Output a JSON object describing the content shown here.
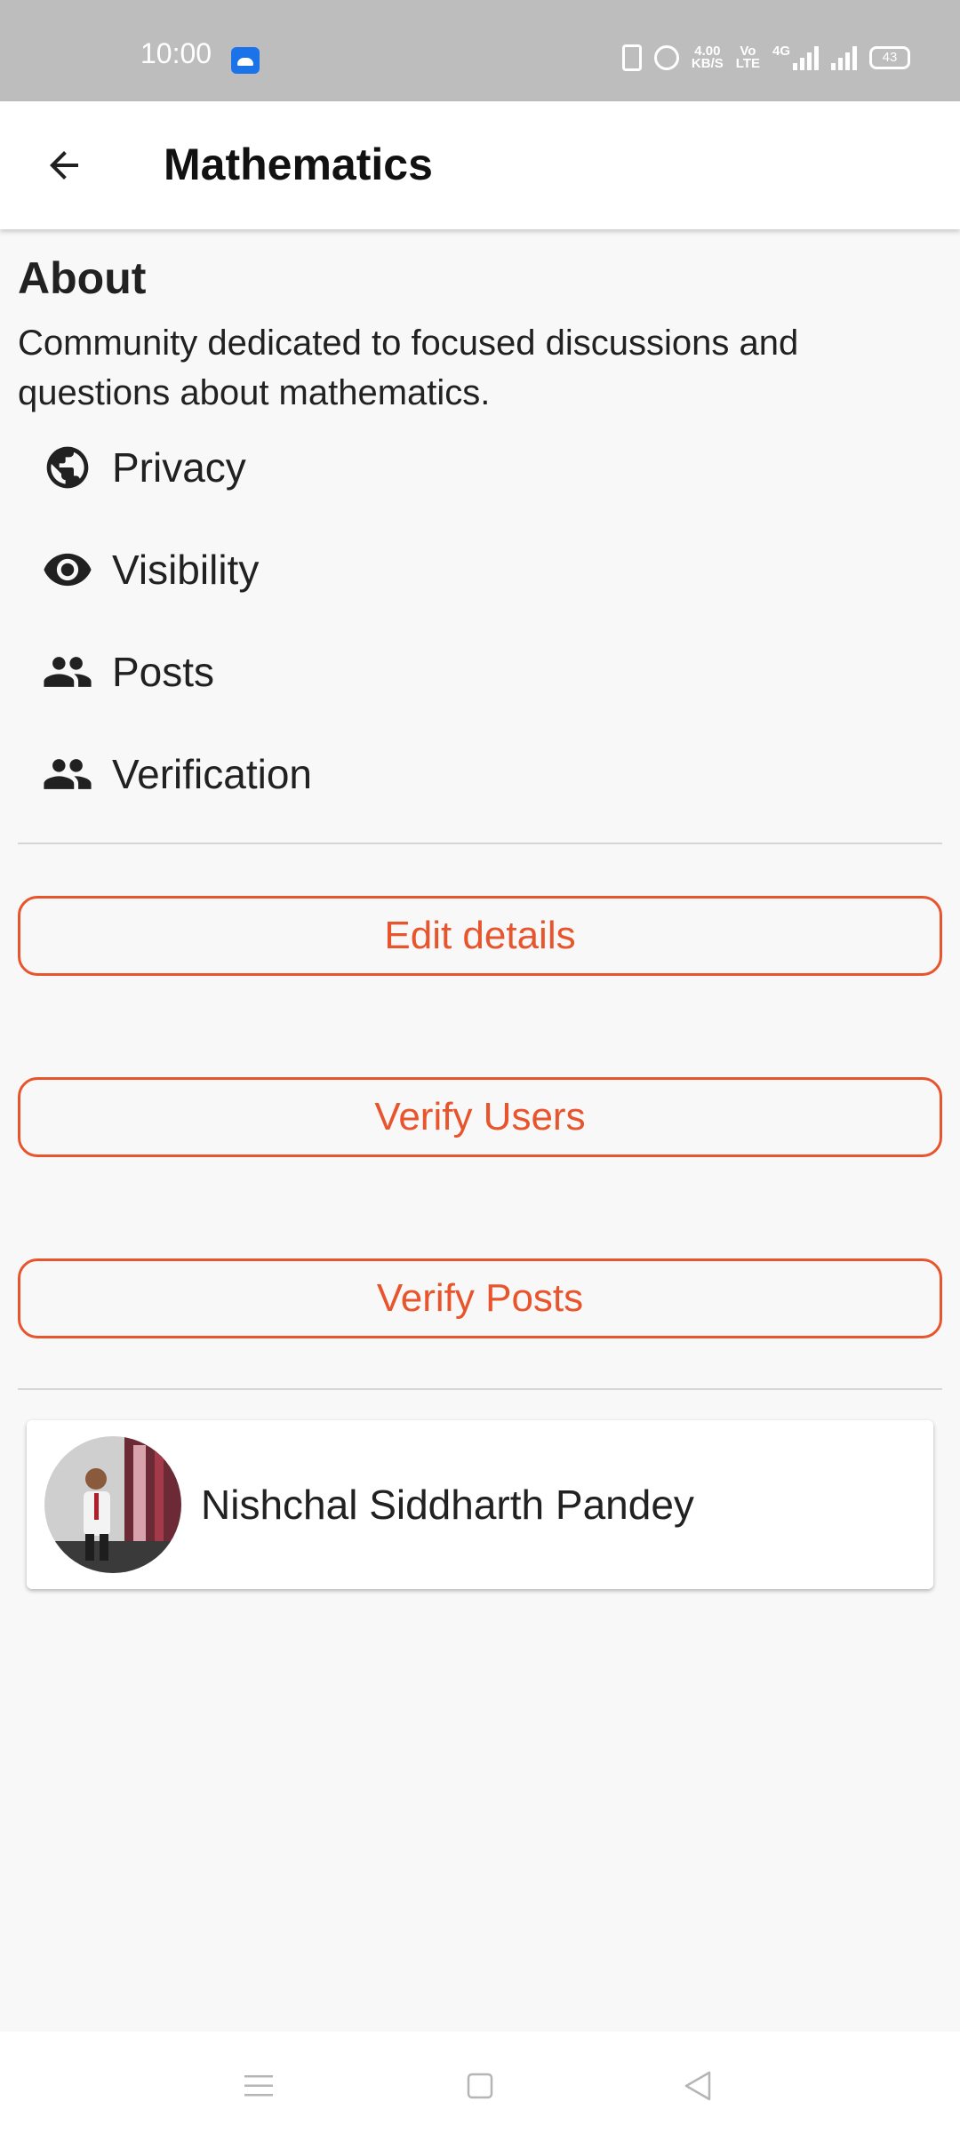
{
  "status_bar": {
    "time": "10:00",
    "net_speed_value": "4.00",
    "net_speed_unit": "KB/S",
    "volte_top": "Vo",
    "volte_bottom": "LTE",
    "network_type": "4G",
    "battery": "43",
    "icons": [
      "android-app-icon",
      "vibrate-icon",
      "alarm-icon",
      "signal-icon",
      "signal-icon",
      "battery-icon"
    ]
  },
  "app_bar": {
    "title": "Mathematics",
    "back_icon": "arrow-back-icon"
  },
  "about": {
    "heading": "About",
    "description": "Community dedicated to focused discussions and questions about mathematics."
  },
  "info_items": [
    {
      "label": "Privacy",
      "icon": "globe-icon"
    },
    {
      "label": "Visibility",
      "icon": "eye-icon"
    },
    {
      "label": "Posts",
      "icon": "people-icon"
    },
    {
      "label": "Verification",
      "icon": "people-icon"
    }
  ],
  "actions": {
    "edit_details": "Edit details",
    "verify_users": "Verify Users",
    "verify_posts": "Verify Posts"
  },
  "members": [
    {
      "name": "Nishchal Siddharth Pandey"
    }
  ],
  "colors": {
    "accent": "#e8542c",
    "status_bar": "#bdbdbd",
    "background": "#f8f8f8"
  },
  "nav_bar": {
    "icons": [
      "menu-icon",
      "home-icon",
      "back-triangle-icon"
    ]
  }
}
